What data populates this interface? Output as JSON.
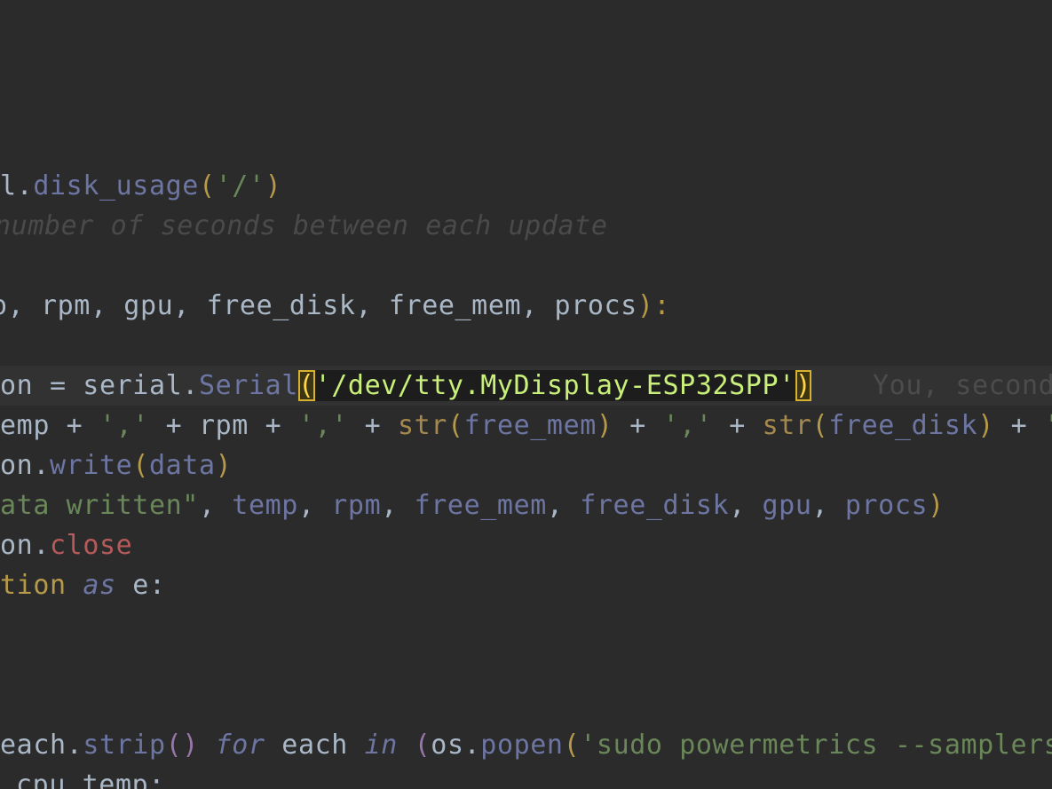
{
  "lines": {
    "l1": {
      "t1": "l.",
      "t2": "disk_usage",
      "t3": "(",
      "t4": "'/'",
      "t5": ")"
    },
    "l2": {
      "comment": "number of seconds between each update"
    },
    "l3": {
      "t1": "o, rpm, gpu, free_disk, free_mem, procs",
      "t2": "):"
    },
    "l4": {
      "t1": "on = serial.",
      "t2": "Serial",
      "t3": "(",
      "t4": "'/dev/tty.MyDisplay-ESP32SPP'",
      "t5": ")",
      "blame": "You, second"
    },
    "l5": {
      "t1": "emp + ",
      "t2": "','",
      "t3": " + rpm + ",
      "t4": "','",
      "t5": " + ",
      "t6": "str",
      "t7": "(",
      "t8": "free_mem",
      "t9": ")",
      "t10": " + ",
      "t11": "','",
      "t12": " + ",
      "t13": "str",
      "t14": "(",
      "t15": "free_disk",
      "t16": ")",
      "t17": " + ",
      "t18": "','"
    },
    "l6": {
      "t1": "on.",
      "t2": "write",
      "t3": "(",
      "t4": "data",
      "t5": ")"
    },
    "l7": {
      "t1": "ata written\"",
      "t2": ", ",
      "t3": "temp",
      "t4": ", ",
      "t5": "rpm",
      "t6": ", ",
      "t7": "free_mem",
      "t8": ", ",
      "t9": "free_disk",
      "t10": ", ",
      "t11": "gpu",
      "t12": ", ",
      "t13": "procs",
      "t14": ")"
    },
    "l8": {
      "t1": "on.",
      "t2": "close"
    },
    "l9": {
      "t1": "tion ",
      "t2": "as",
      "t3": " e:"
    },
    "l10": {
      "t1": "each.",
      "t2": "strip",
      "t3": "()",
      "t4": " ",
      "t5": "for",
      "t6": " each ",
      "t7": "in",
      "t8": " ",
      "t9": "(",
      "t10": "os.",
      "t11": "popen",
      "t12": "(",
      "t13": "'sudo powermetrics --samplers sm"
    },
    "l11": {
      "t1": "cpu_temp:"
    }
  },
  "colors": {
    "background": "#2b2b2b",
    "plain": "#a9b7c6",
    "bracket": "#b69a4a",
    "call": "#6d75a2",
    "string": "#6a8759",
    "comment": "#4a4a4a",
    "highlight_outline": "#d8b130",
    "highlight_string": "#c9f07a"
  }
}
